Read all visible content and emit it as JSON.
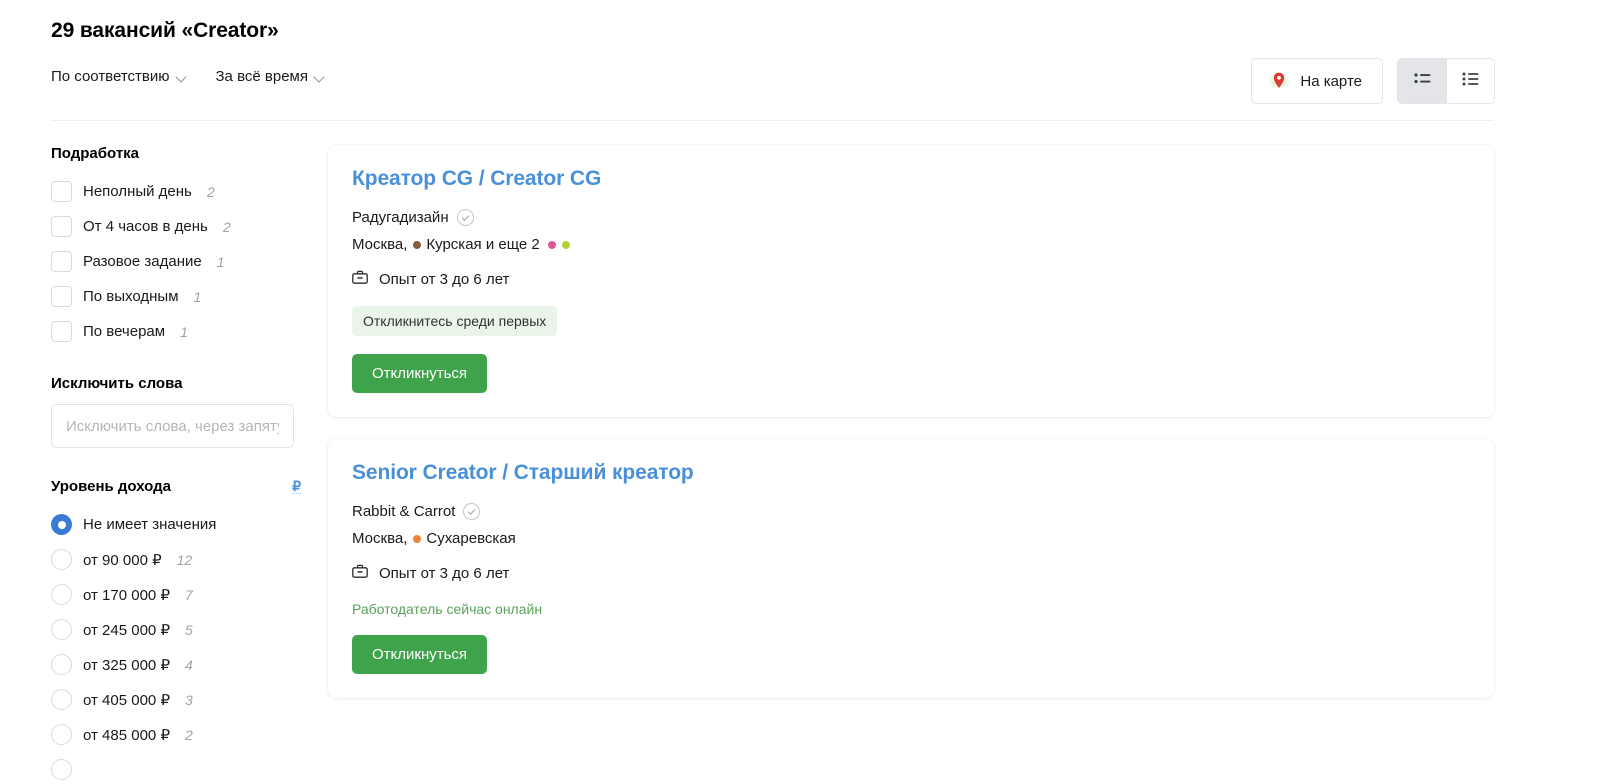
{
  "header": {
    "title": "29 вакансий «Creator»",
    "sort_controls": [
      {
        "label": "По соответствию",
        "icon": "chevron-down-icon"
      },
      {
        "label": "За всё время",
        "icon": "chevron-down-icon"
      }
    ],
    "map_button": {
      "label": "На карте",
      "icon": "map-pin-icon"
    },
    "view_toggle": [
      {
        "icon": "compact-list-icon",
        "active": true
      },
      {
        "icon": "detailed-list-icon",
        "active": false
      }
    ]
  },
  "sidebar": {
    "part_time": {
      "title": "Подработка",
      "options": [
        {
          "label": "Неполный день",
          "count": "2"
        },
        {
          "label": "От 4 часов в день",
          "count": "2"
        },
        {
          "label": "Разовое задание",
          "count": "1"
        },
        {
          "label": "По выходным",
          "count": "1"
        },
        {
          "label": "По вечерам",
          "count": "1"
        }
      ]
    },
    "exclude_words": {
      "title": "Исключить слова",
      "value": "",
      "placeholder": "Исключить слова, через запятую"
    },
    "income": {
      "title": "Уровень доходa",
      "title_text": "Уровень дохода",
      "currency_hint": "₽",
      "options": [
        {
          "label": "Не имеет значения",
          "count": "",
          "selected": true
        },
        {
          "label": "от 90 000 ₽",
          "count": "12",
          "selected": false
        },
        {
          "label": "от 170 000 ₽",
          "count": "7",
          "selected": false
        },
        {
          "label": "от 245 000 ₽",
          "count": "5",
          "selected": false
        },
        {
          "label": "от 325 000 ₽",
          "count": "4",
          "selected": false
        },
        {
          "label": "от 405 000 ₽",
          "count": "3",
          "selected": false
        },
        {
          "label": "от 485 000 ₽",
          "count": "2",
          "selected": false
        }
      ]
    }
  },
  "vacancies": [
    {
      "title": "Креатор CG / Creator CG",
      "company": "Радугадизайн",
      "verified": true,
      "city": "Москва,",
      "metro": "Курская и еще 2",
      "metro_color": "#8a5a3c",
      "extra_metro_colors": [
        "#e0568f",
        "#b2d336"
      ],
      "experience": "Опыт от 3 до 6 лет",
      "badge": "Откликнитесь среди первых",
      "note": "",
      "apply_label": "Откликнуться"
    },
    {
      "title": "Senior Creator / Старший креатор",
      "company": "Rabbit & Carrot",
      "verified": true,
      "city": "Москва,",
      "metro": "Сухаревская",
      "metro_color": "#ef8236",
      "extra_metro_colors": [],
      "experience": "Опыт от 3 до 6 лет",
      "badge": "",
      "note": "Работодатель сейчас онлайн",
      "apply_label": "Откликнуться"
    }
  ],
  "colors": {
    "link": "#4a90d9",
    "apply_green": "#3fa34b",
    "radio_blue": "#3a7cd4",
    "badge_bg": "#eaf5ea"
  }
}
